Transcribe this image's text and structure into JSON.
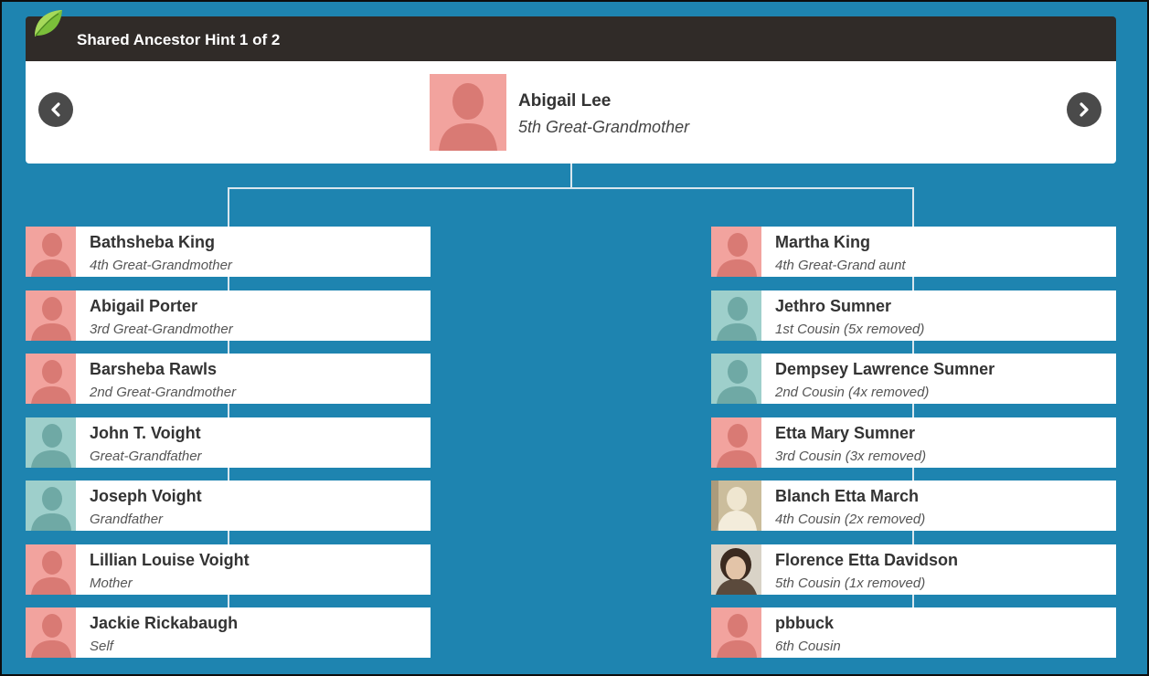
{
  "header": {
    "title": "Shared Ancestor Hint 1 of 2"
  },
  "ancestor": {
    "name": "Abigail Lee",
    "relationship": "5th Great-Grandmother"
  },
  "left_line": [
    {
      "name": "Bathsheba King",
      "relationship": "4th Great-Grandmother",
      "photo": "female"
    },
    {
      "name": "Abigail Porter",
      "relationship": "3rd Great-Grandmother",
      "photo": "female"
    },
    {
      "name": "Barsheba Rawls",
      "relationship": "2nd Great-Grandmother",
      "photo": "female"
    },
    {
      "name": "John T. Voight",
      "relationship": "Great-Grandfather",
      "photo": "male"
    },
    {
      "name": "Joseph Voight",
      "relationship": "Grandfather",
      "photo": "male"
    },
    {
      "name": "Lillian Louise Voight",
      "relationship": "Mother",
      "photo": "female"
    },
    {
      "name": "Jackie Rickabaugh",
      "relationship": "Self",
      "photo": "female"
    }
  ],
  "right_line": [
    {
      "name": "Martha King",
      "relationship": "4th Great-Grand aunt",
      "photo": "female"
    },
    {
      "name": "Jethro Sumner",
      "relationship": "1st Cousin (5x removed)",
      "photo": "male"
    },
    {
      "name": "Dempsey Lawrence Sumner",
      "relationship": "2nd Cousin (4x removed)",
      "photo": "male"
    },
    {
      "name": "Etta Mary Sumner",
      "relationship": "3rd Cousin (3x removed)",
      "photo": "female"
    },
    {
      "name": "Blanch Etta March",
      "relationship": "4th Cousin (2x removed)",
      "photo": "real1"
    },
    {
      "name": "Florence Etta Davidson",
      "relationship": "5th Cousin (1x removed)",
      "photo": "real2"
    },
    {
      "name": "pbbuck",
      "relationship": "6th Cousin",
      "photo": "female"
    }
  ],
  "icons": {
    "logo": "leaf-icon",
    "prev": "chevron-left-icon",
    "next": "chevron-right-icon",
    "placeholder": "person-silhouette-icon"
  },
  "colors": {
    "background": "#1e84b0",
    "header": "#302b28",
    "female": "#f2a39e",
    "male": "#9ecfcb"
  }
}
